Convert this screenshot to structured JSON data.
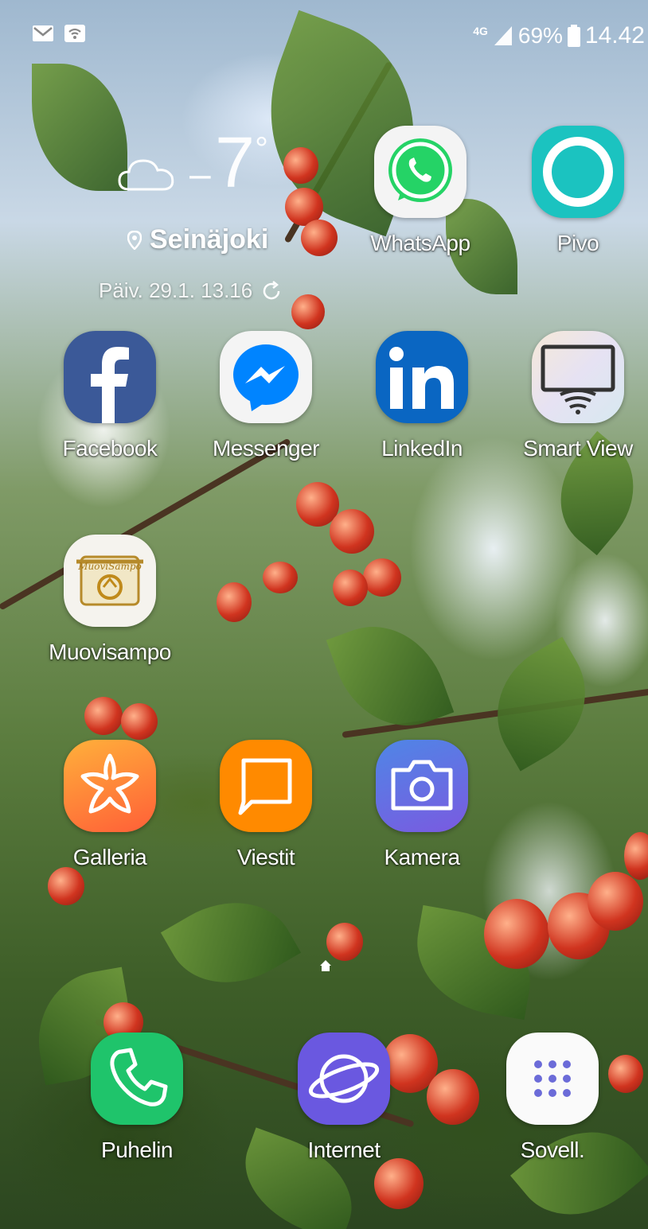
{
  "status_bar": {
    "network_type": "4G",
    "battery_percent": "69%",
    "time": "14.42",
    "left_icons": [
      "email-notification-icon",
      "wifi-calling-icon"
    ]
  },
  "weather_widget": {
    "temperature": "7",
    "degree_symbol": "°",
    "temperature_sign": "–",
    "condition_icon": "cloud-icon",
    "location": "Seinäjoki",
    "updated": "Päiv. 29.1. 13.16"
  },
  "apps": [
    {
      "label": "WhatsApp",
      "icon": "whatsapp-icon"
    },
    {
      "label": "Pivo",
      "icon": "pivo-icon"
    },
    {
      "label": "Facebook",
      "icon": "facebook-icon"
    },
    {
      "label": "Messenger",
      "icon": "messenger-icon"
    },
    {
      "label": "LinkedIn",
      "icon": "linkedin-icon"
    },
    {
      "label": "Smart View",
      "icon": "smart-view-icon"
    },
    {
      "label": "Muovisampo",
      "icon": "muovisampo-icon",
      "logo_text": "MuoviSampo"
    },
    {
      "label": "Galleria",
      "icon": "gallery-icon"
    },
    {
      "label": "Viestit",
      "icon": "messages-icon"
    },
    {
      "label": "Kamera",
      "icon": "camera-icon"
    }
  ],
  "dock": [
    {
      "label": "Puhelin",
      "icon": "phone-icon"
    },
    {
      "label": "Internet",
      "icon": "internet-icon"
    },
    {
      "label": "Sovell.",
      "icon": "apps-grid-icon"
    }
  ],
  "colors": {
    "whatsapp": "#25D366",
    "pivo": "#1BC3C0",
    "facebook": "#3B5998",
    "messenger": "#0084FF",
    "linkedin": "#0A66C2",
    "gallery": "#FF6A3D",
    "messages": "#FF8A00",
    "camera": "#6A6DE0",
    "phone": "#1FC46B",
    "internet": "#6A58E0"
  }
}
